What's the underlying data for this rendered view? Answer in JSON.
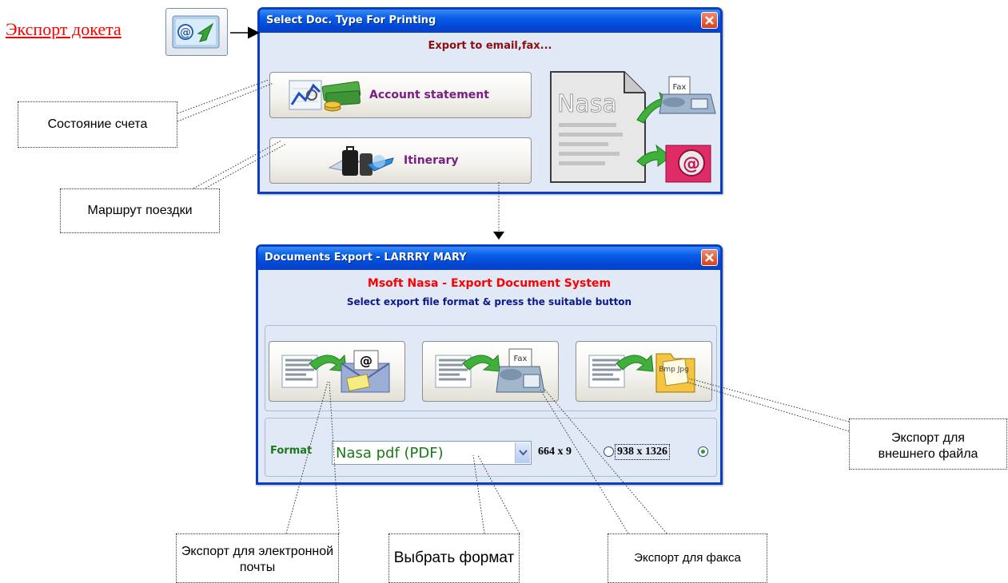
{
  "top_link": {
    "label": "Экспорт докета"
  },
  "select_dialog": {
    "title": "Select Doc. Type For Printing",
    "subtitle": "Export to email,fax...",
    "buttons": {
      "account_statement": "Account statement",
      "itinerary": "Itinerary"
    },
    "illustration": {
      "doc_label": "Nasa",
      "fax_label": "Fax"
    }
  },
  "export_dialog": {
    "title": "Documents Export - LARRRY MARY",
    "heading": "Msoft Nasa - Export Document System",
    "instruction": "Select export file format & press the suitable button",
    "export_buttons": {
      "email": {
        "icon": "email-export-icon",
        "symbol": "@"
      },
      "fax": {
        "icon": "fax-export-icon",
        "symbol": "Fax"
      },
      "file": {
        "icon": "file-export-icon",
        "symbol": "Bmp Jpg"
      }
    },
    "format": {
      "label": "Format",
      "selected": "Nasa pdf (PDF)",
      "size_small": "664 x 9",
      "size_large": "938 x 1326",
      "selected_size": "938 x 1326"
    }
  },
  "callouts": {
    "account_state": "Состояние счета",
    "route": "Маршрут поездки",
    "email_export": "Экспорт для электронной почты",
    "choose_format": "Выбрать формат",
    "fax_export": "Экспорт для факса",
    "file_export": "Экспорт для внешнего файла"
  },
  "colors": {
    "title_blue": "#0a3fc4",
    "subtitle_red": "#8b0f0f",
    "heading_red": "#ff0000",
    "instruction_navy": "#0a1a8c",
    "button_purple": "#7a1d86",
    "format_green": "#1a7a1a",
    "link_red": "#ff0000"
  }
}
